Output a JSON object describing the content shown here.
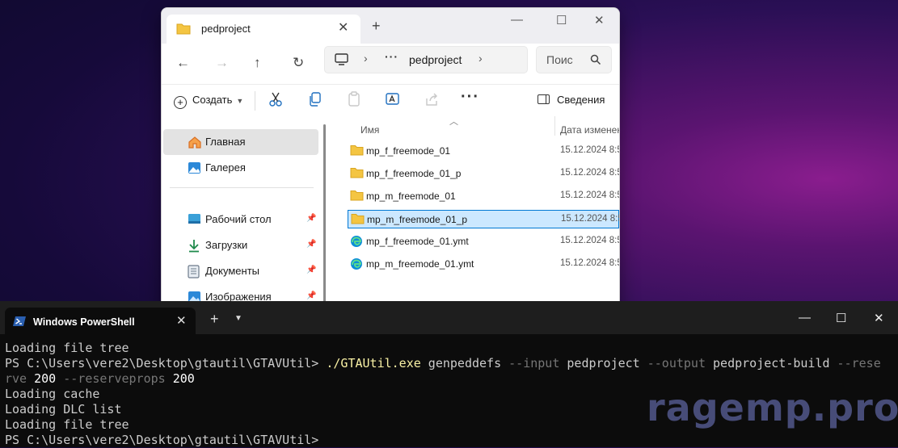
{
  "explorer": {
    "tab_title": "pedproject",
    "tab_close": "✕",
    "new_tab": "+",
    "window_controls": {
      "minimize": "—",
      "maximize": "☐",
      "close": "✕"
    },
    "nav": {
      "back": "←",
      "forward": "→",
      "up": "↑",
      "refresh": "↻"
    },
    "address": {
      "sep": "›",
      "ellipsis": "···",
      "crumb": "pedproject"
    },
    "search": {
      "placeholder": "Поис",
      "icon": "search-icon"
    },
    "toolbar": {
      "create_label": "Создать",
      "more_label": "···",
      "details_label": "Сведения"
    },
    "sidebar": {
      "items": [
        {
          "label": "Главная",
          "icon": "home-icon",
          "active": true
        },
        {
          "label": "Галерея",
          "icon": "gallery-icon"
        },
        {
          "label": "Рабочий стол",
          "icon": "desktop-icon",
          "pinned": true
        },
        {
          "label": "Загрузки",
          "icon": "downloads-icon",
          "pinned": true
        },
        {
          "label": "Документы",
          "icon": "documents-icon",
          "pinned": true
        },
        {
          "label": "Изображения",
          "icon": "pictures-icon",
          "pinned": true
        }
      ],
      "pin_glyph": "📌"
    },
    "columns": {
      "name": "Имя",
      "date": "Дата изменен"
    },
    "files": [
      {
        "name": "mp_f_freemode_01",
        "date": "15.12.2024 8:5",
        "type": "folder"
      },
      {
        "name": "mp_f_freemode_01_p",
        "date": "15.12.2024 8:5",
        "type": "folder"
      },
      {
        "name": "mp_m_freemode_01",
        "date": "15.12.2024 8:5",
        "type": "folder"
      },
      {
        "name": "mp_m_freemode_01_p",
        "date": "15.12.2024 8:5",
        "type": "folder",
        "selected": true
      },
      {
        "name": "mp_f_freemode_01.ymt",
        "date": "15.12.2024 8:5",
        "type": "edge-file"
      },
      {
        "name": "mp_m_freemode_01.ymt",
        "date": "15.12.2024 8:5",
        "type": "edge-file"
      }
    ]
  },
  "terminal": {
    "tab_title": "Windows PowerShell",
    "tab_close": "✕",
    "new_tab": "+",
    "dropdown": "⌄",
    "window_controls": {
      "minimize": "—",
      "maximize": "☐",
      "close": "✕"
    },
    "lines": {
      "l1": "Loading file tree",
      "l2_prompt": "PS C:\\Users\\vere2\\Desktop\\gtautil\\GTAVUtil> ",
      "l2_exe": "./GTAUtil.exe",
      "l2_cmd": " genpeddefs ",
      "l2_input_flag": "--input",
      "l2_input_val": " pedproject ",
      "l2_output_flag": "--output",
      "l2_output_val": " pedproject-build ",
      "l2_rese_flag": "--rese",
      "l3_rve_flag": "rve",
      "l3_val1": " 200 ",
      "l3_props_flag": "--reserveprops",
      "l3_val2": " 200",
      "l4": "Loading cache",
      "l5": "Loading DLC list",
      "l6": "Loading file tree",
      "l7_prompt": "PS C:\\Users\\vere2\\Desktop\\gtautil\\GTAVUtil>"
    }
  },
  "watermark": "ragemp.pro",
  "colors": {
    "accent": "#0078d4",
    "selection": "#cce8ff",
    "folder": "#f4c542",
    "terminal_bg": "#0c0c0c",
    "exe_yellow": "#f9f1a5",
    "flag_gray": "#767676"
  }
}
